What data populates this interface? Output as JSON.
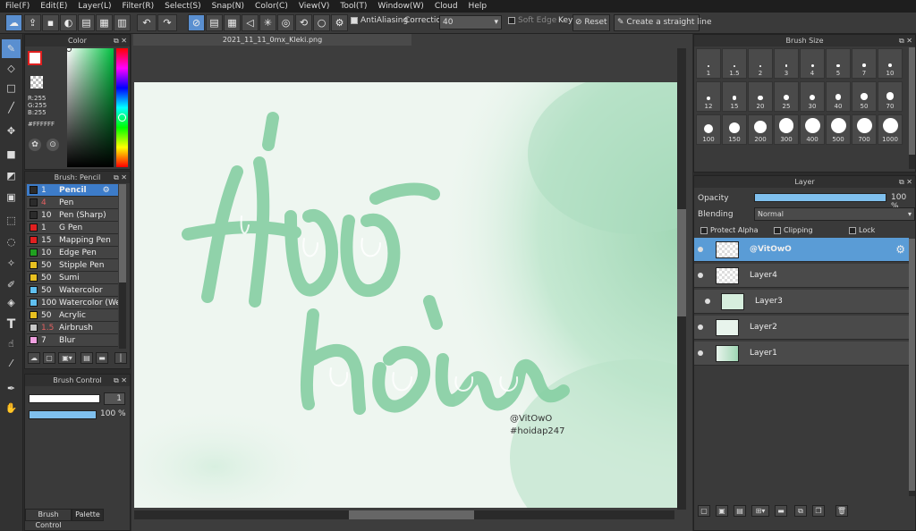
{
  "menu": [
    "File(F)",
    "Edit(E)",
    "Layer(L)",
    "Filter(R)",
    "Select(S)",
    "Snap(N)",
    "Color(C)",
    "View(V)",
    "Tool(T)",
    "Window(W)",
    "Cloud",
    "Help"
  ],
  "toolbar": {
    "antialiasing_label": "AntiAliasing",
    "correction_label": "Correction",
    "correction_value": "40",
    "soft_edge_label": "Soft Edge",
    "key_label": "Key",
    "reset_label": "Reset",
    "straight_line_label": "Create a straight line"
  },
  "color_panel": {
    "title": "Color",
    "r": "R:255",
    "g": "G:255",
    "b": "B:255",
    "hex": "#FFFFFF"
  },
  "brush_panel": {
    "title": "Brush: Pencil",
    "items": [
      {
        "size": "1",
        "name": "Pencil",
        "color": "#2b2b2b"
      },
      {
        "size": "4",
        "name": "Pen",
        "color": "#2b2b2b"
      },
      {
        "size": "10",
        "name": "Pen (Sharp)",
        "color": "#2b2b2b"
      },
      {
        "size": "1",
        "name": "G Pen",
        "color": "#e02020"
      },
      {
        "size": "15",
        "name": "Mapping Pen",
        "color": "#e02020"
      },
      {
        "size": "10",
        "name": "Edge Pen",
        "color": "#20a020"
      },
      {
        "size": "50",
        "name": "Stipple Pen",
        "color": "#e8c020"
      },
      {
        "size": "50",
        "name": "Sumi",
        "color": "#e8c020"
      },
      {
        "size": "50",
        "name": "Watercolor",
        "color": "#60c0f0"
      },
      {
        "size": "100",
        "name": "Watercolor (Wet)",
        "color": "#60c0f0"
      },
      {
        "size": "50",
        "name": "Acrylic",
        "color": "#e8c020"
      },
      {
        "size": "1.5",
        "name": "Airbrush",
        "color": "#c8c8c8"
      },
      {
        "size": "7",
        "name": "Blur",
        "color": "#f0a0e0"
      }
    ]
  },
  "brush_control": {
    "title": "Brush Control",
    "size_value": "1",
    "opacity_value": "100 %",
    "opacity_pct": 100,
    "tab_brush_control": "Brush Control",
    "tab_palette": "Palette"
  },
  "canvas": {
    "tab_title": "2021_11_11_0mx_Kleki.png",
    "signature_line1": "@VitOwO",
    "signature_line2": "#hoidap247"
  },
  "brush_size_panel": {
    "title": "Brush Size",
    "sizes": [
      "1",
      "1.5",
      "2",
      "3",
      "4",
      "5",
      "7",
      "10",
      "12",
      "15",
      "20",
      "25",
      "30",
      "40",
      "50",
      "70",
      "100",
      "150",
      "200",
      "300",
      "400",
      "500",
      "700",
      "1000"
    ]
  },
  "layer_panel": {
    "title": "Layer",
    "opacity_label": "Opacity",
    "opacity_value": "100 %",
    "opacity_pct": 100,
    "blending_label": "Blending",
    "blending_value": "Normal",
    "protect_alpha_label": "Protect Alpha",
    "clipping_label": "Clipping",
    "lock_label": "Lock",
    "layers": [
      {
        "name": "@VitOwO",
        "selected": true
      },
      {
        "name": "Layer4",
        "selected": false
      },
      {
        "name": "Layer3",
        "selected": false
      },
      {
        "name": "Layer2",
        "selected": false
      },
      {
        "name": "Layer1",
        "selected": false
      }
    ]
  },
  "colors": {
    "accent": "#5a9cd6",
    "lettering": "#7fcaa0"
  }
}
